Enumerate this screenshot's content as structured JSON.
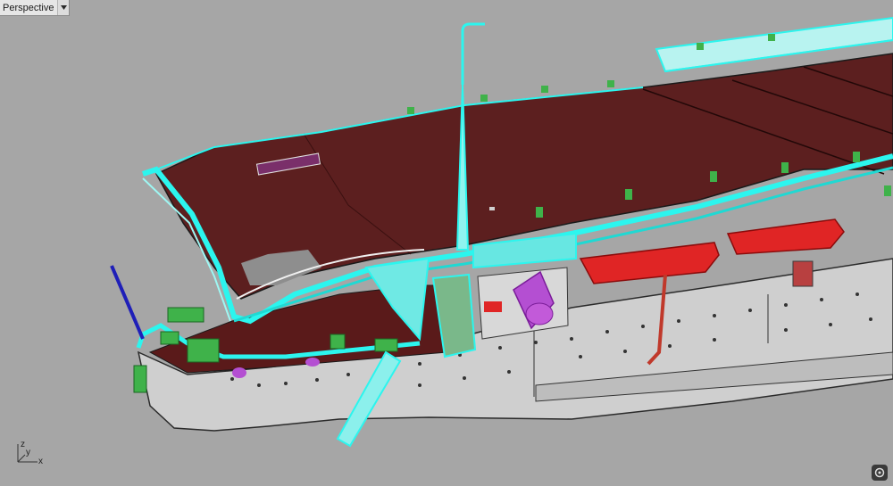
{
  "viewport": {
    "title": "Perspective",
    "menu_icon": "triangle-down-icon"
  },
  "axes": {
    "x_label": "x",
    "y_label": "y",
    "z_label": "z"
  },
  "nav_icon": "camera-icon",
  "colors": {
    "background": "#a6a6a6",
    "deck": "#5c1f1f",
    "hull": "#cfcfcf",
    "selected": "#2cf5ee",
    "lifeboat": "#e02525",
    "gun": "#3fb24a",
    "funnel": "#b44fd2",
    "mast": "#1f1fb8"
  }
}
